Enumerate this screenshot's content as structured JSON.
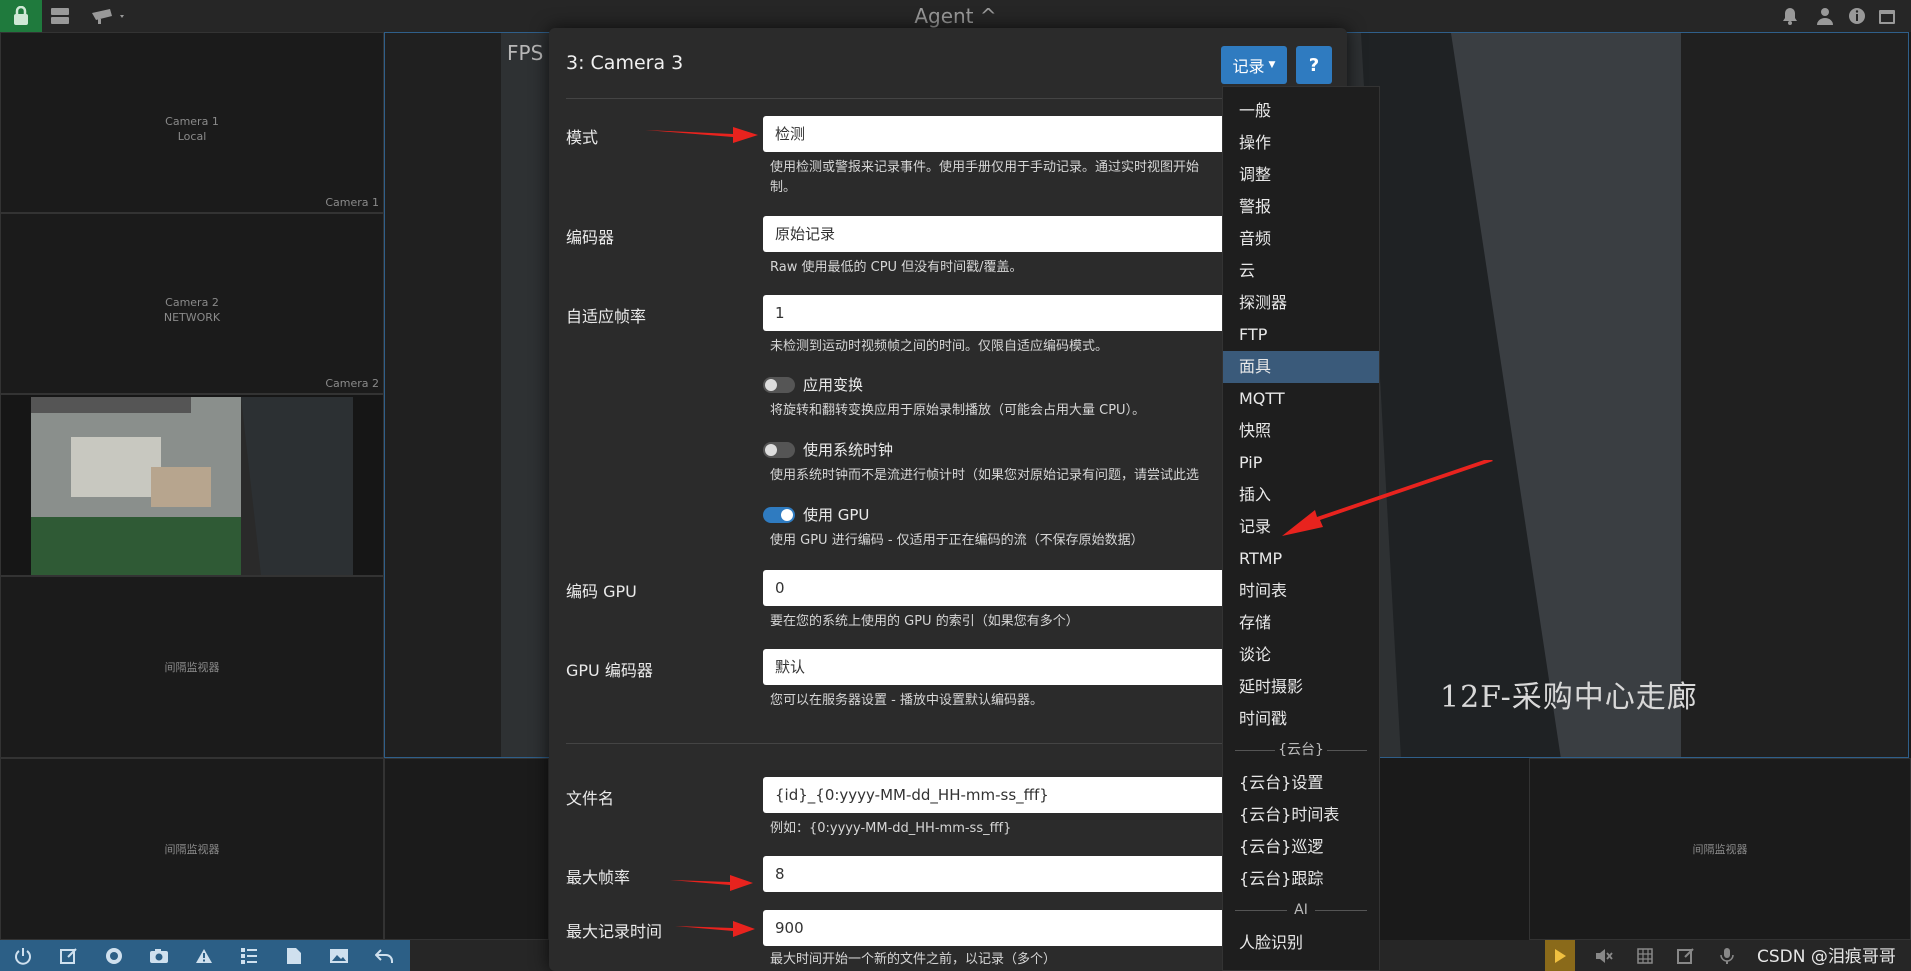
{
  "app": {
    "title": "Agent",
    "caret": "^"
  },
  "topbar_icons": [
    "lock-icon",
    "server-icon",
    "camera-icon",
    "bell-icon",
    "user-icon",
    "info-icon",
    "calendar-icon"
  ],
  "tiles": [
    {
      "line1": "Camera 1",
      "line2": "Local",
      "footer": "Camera 1"
    },
    {
      "line1": "Camera 2",
      "line2": "NETWORK",
      "footer": "Camera 2"
    },
    {
      "center": "间隔监视器"
    },
    {
      "center": "间隔监视器"
    },
    {
      "center": "间隔监视器"
    }
  ],
  "background": {
    "fps_label": "FPS",
    "overlay": "12F-采购中心走廊"
  },
  "modal": {
    "title": "3: Camera 3",
    "record_button": "记录",
    "help_button": "?",
    "fields": {
      "mode": {
        "label": "模式",
        "value": "检测",
        "help1": "使用检测或警报来记录事件。使用手册仅用于手动记录。通过实时视图开始",
        "help2": "制。"
      },
      "encoder": {
        "label": "编码器",
        "value": "原始记录",
        "help": "Raw 使用最低的 CPU 但没有时间戳/覆盖。"
      },
      "adaptive_fps": {
        "label": "自适应帧率",
        "value": "1",
        "help": "未检测到运动时视频帧之间的时间。仅限自适应编码模式。"
      },
      "apply_transform": {
        "label": "应用变换",
        "help": "将旋转和翻转变换应用于原始录制播放（可能会占用大量 CPU）。"
      },
      "system_clock": {
        "label": "使用系统时钟",
        "help": "使用系统时钟而不是流进行帧计时（如果您对原始记录有问题，请尝试此选"
      },
      "use_gpu": {
        "label": "使用 GPU",
        "help": "使用 GPU 进行编码 - 仅适用于正在编码的流（不保存原始数据）"
      },
      "encode_gpu": {
        "label": "编码 GPU",
        "value": "0",
        "help": "要在您的系统上使用的 GPU 的索引（如果您有多个）"
      },
      "gpu_encoder": {
        "label": "GPU 编码器",
        "value": "默认",
        "help": "您可以在服务器设置 - 播放中设置默认编码器。"
      },
      "filename": {
        "label": "文件名",
        "value": "{id}_{0:yyyy-MM-dd_HH-mm-ss_fff}",
        "help": "例如：{0:yyyy-MM-dd_HH-mm-ss_fff}"
      },
      "max_fps": {
        "label": "最大帧率",
        "value": "8"
      },
      "max_record_time": {
        "label": "最大记录时间",
        "value": "900",
        "help": "最大时间开始一个新的文件之前，以记录（多个）"
      }
    }
  },
  "dropdown": {
    "items": [
      "一般",
      "操作",
      "调整",
      "警报",
      "音频",
      "云",
      "探测器",
      "FTP",
      "面具",
      "MQTT",
      "快照",
      "PiP",
      "插入",
      "记录",
      "RTMP",
      "时间表",
      "存储",
      "谈论",
      "延时摄影",
      "时间戳"
    ],
    "active": "面具",
    "ptz_header": "{云台}",
    "ptz_items": [
      "{云台}设置",
      "{云台}时间表",
      "{云台}巡逻",
      "{云台}跟踪"
    ],
    "ai_header": "AI",
    "ai_items": [
      "人脸识别"
    ]
  },
  "watermark": "CSDN @泪痕哥哥",
  "colors": {
    "accent": "#2f7bc0",
    "lock": "#1f7a3d",
    "active_item": "#3a5a7a",
    "arrow": "#e8231e"
  }
}
